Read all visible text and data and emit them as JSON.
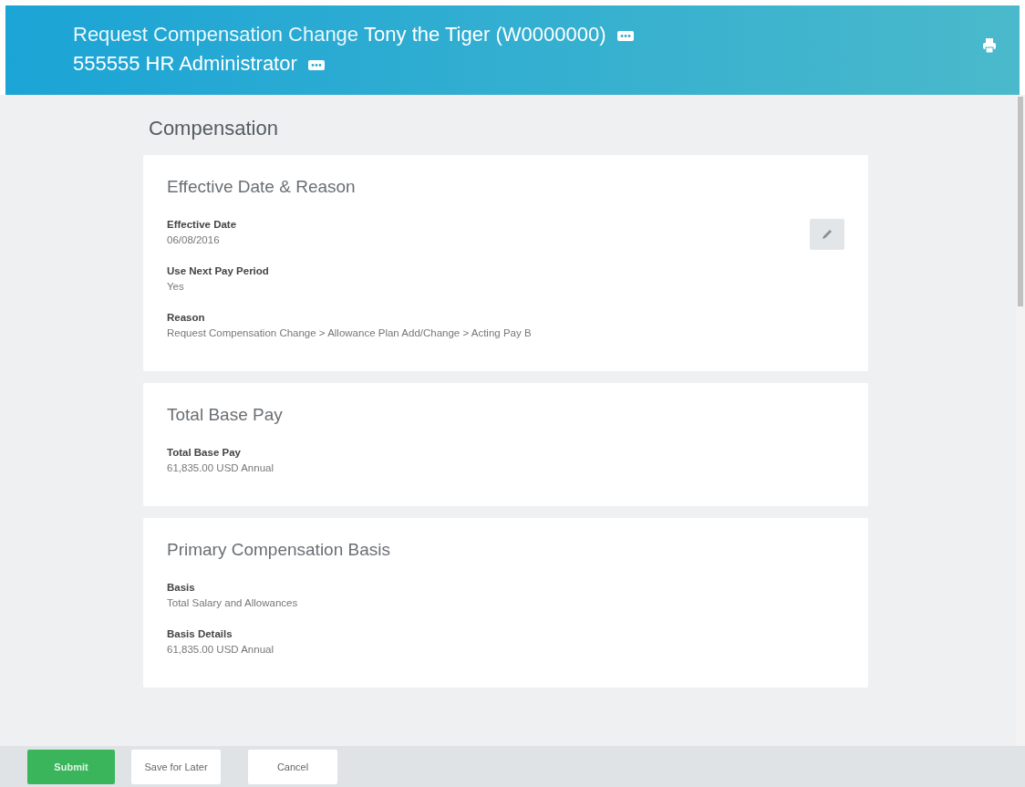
{
  "header": {
    "title_parts": [
      {
        "text": "Request Compensation Change",
        "kind": "light"
      },
      {
        "text": "Tony the Tiger (W0000000)",
        "kind": "link"
      },
      {
        "text": "555555 HR Administrator",
        "kind": "link"
      }
    ]
  },
  "page_title": "Compensation",
  "cards": [
    {
      "title": "Effective Date & Reason",
      "editable": true,
      "fields": [
        {
          "label": "Effective Date",
          "value": "06/08/2016"
        },
        {
          "label": "Use Next Pay Period",
          "value": "Yes"
        },
        {
          "label": "Reason",
          "value": "Request Compensation Change > Allowance Plan Add/Change > Acting Pay B"
        }
      ]
    },
    {
      "title": "Total Base Pay",
      "editable": false,
      "fields": [
        {
          "label": "Total Base Pay",
          "value": "61,835.00 USD Annual"
        }
      ]
    },
    {
      "title": "Primary Compensation Basis",
      "editable": false,
      "fields": [
        {
          "label": "Basis",
          "value": "Total Salary and Allowances"
        },
        {
          "label": "Basis Details",
          "value": "61,835.00 USD Annual"
        }
      ]
    }
  ],
  "footer": {
    "buttons": [
      {
        "label": "Submit",
        "kind": "primary"
      },
      {
        "label": "Save for Later",
        "kind": "secondary"
      },
      {
        "label": "Cancel",
        "kind": "secondary"
      }
    ]
  }
}
